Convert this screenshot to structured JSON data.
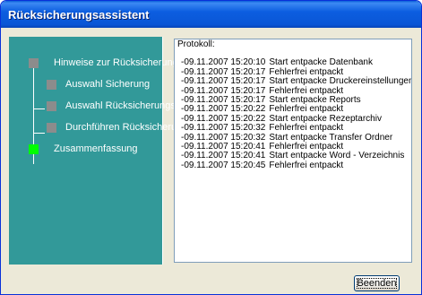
{
  "window": {
    "title": "Rücksicherungsassistent"
  },
  "steps": [
    {
      "label": "Hinweise zur Rücksicherung",
      "state": "inactive"
    },
    {
      "label": "Auswahl Sicherung",
      "state": "inactive"
    },
    {
      "label": "Auswahl Rücksicherungsart",
      "state": "inactive"
    },
    {
      "label": "Durchführen Rücksicherung",
      "state": "inactive"
    },
    {
      "label": "Zusammenfassung",
      "state": "active"
    }
  ],
  "log": {
    "heading": "Protokoll:",
    "entries": [
      {
        "timestamp": "-09.11.2007 15:20:10",
        "message": "Start entpacke Datenbank"
      },
      {
        "timestamp": "-09.11.2007 15:20:17",
        "message": "Fehlerfrei entpackt"
      },
      {
        "timestamp": "-09.11.2007 15:20:17",
        "message": "Start entpacke Druckereinstellungen"
      },
      {
        "timestamp": "-09.11.2007 15:20:17",
        "message": "Fehlerfrei entpackt"
      },
      {
        "timestamp": "-09.11.2007 15:20:17",
        "message": "Start entpacke Reports"
      },
      {
        "timestamp": "-09.11.2007 15:20:22",
        "message": "Fehlerfrei entpackt"
      },
      {
        "timestamp": "-09.11.2007 15:20:22",
        "message": "Start entpacke Rezeptarchiv"
      },
      {
        "timestamp": "-09.11.2007 15:20:32",
        "message": "Fehlerfrei entpackt"
      },
      {
        "timestamp": "-09.11.2007 15:20:32",
        "message": "Start entpacke Transfer Ordner"
      },
      {
        "timestamp": "-09.11.2007 15:20:41",
        "message": "Fehlerfrei entpackt"
      },
      {
        "timestamp": "-09.11.2007 15:20:41",
        "message": "Start entpacke Word - Verzeichnis"
      },
      {
        "timestamp": "-09.11.2007 15:20:45",
        "message": "Fehlerfrei entpackt"
      }
    ]
  },
  "buttons": {
    "finish_label": "Beenden"
  },
  "colors": {
    "side_panel": "#329999",
    "step_inactive": "#8c8c8c",
    "step_active": "#00ff00",
    "titlebar": "#0a56d6"
  }
}
